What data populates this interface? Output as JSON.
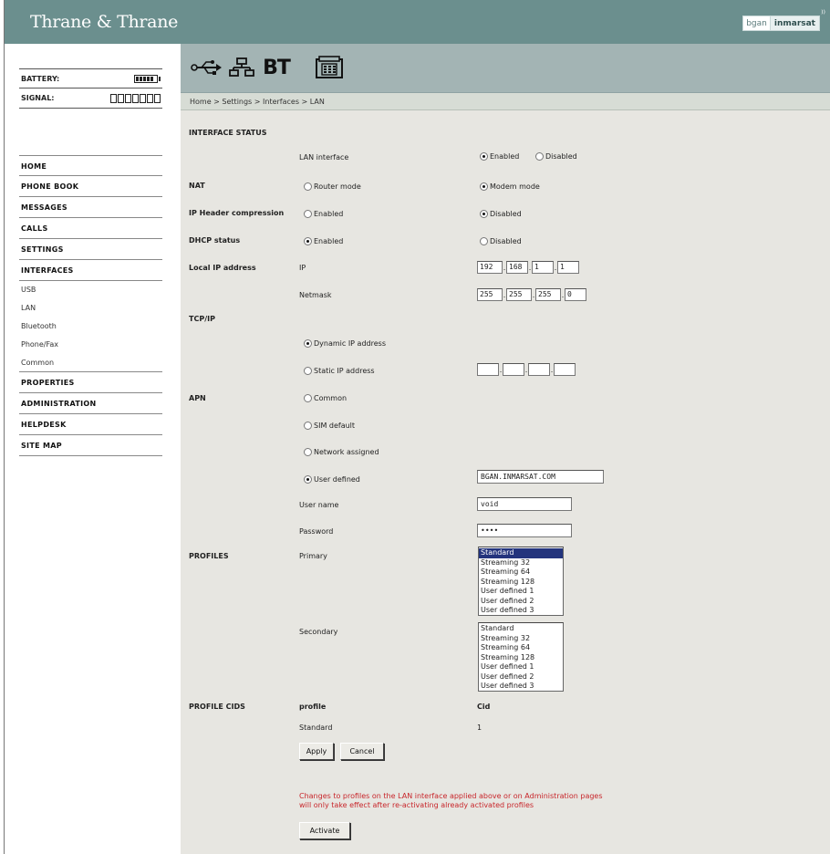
{
  "header": {
    "brand": "Thrane & Thrane",
    "partner_left": "bgan",
    "partner_right": "inmarsat"
  },
  "status": {
    "battery_label": "BATTERY:",
    "signal_label": "SIGNAL:",
    "signal_bars": 7
  },
  "menu": {
    "home": "HOME",
    "phone_book": "PHONE BOOK",
    "messages": "MESSAGES",
    "calls": "CALLS",
    "settings": "SETTINGS",
    "interfaces": "INTERFACES",
    "sub_usb": "USB",
    "sub_lan": "LAN",
    "sub_bluetooth": "Bluetooth",
    "sub_phonefax": "Phone/Fax",
    "sub_common": "Common",
    "properties": "PROPERTIES",
    "administration": "ADMINISTRATION",
    "helpdesk": "HELPDESK",
    "site_map": "SITE MAP"
  },
  "iconbar": {
    "bt_label": "BT"
  },
  "breadcrumb": "Home > Settings > Interfaces > LAN",
  "form": {
    "interface_status": {
      "title": "INTERFACE STATUS",
      "label": "LAN interface",
      "enabled": "Enabled",
      "disabled": "Disabled",
      "selected": "Enabled"
    },
    "nat": {
      "title": "NAT",
      "router": "Router mode",
      "modem": "Modem mode",
      "selected": "Modem mode"
    },
    "ip_header": {
      "title": "IP Header compression",
      "enabled": "Enabled",
      "disabled": "Disabled",
      "selected": "Disabled"
    },
    "dhcp": {
      "title": "DHCP status",
      "enabled": "Enabled",
      "disabled": "Disabled",
      "selected": "Enabled"
    },
    "local_ip": {
      "title": "Local IP address",
      "ip_label": "IP",
      "ip": [
        "192",
        "168",
        "1",
        "1"
      ],
      "netmask_label": "Netmask",
      "netmask": [
        "255",
        "255",
        "255",
        "0"
      ]
    },
    "tcpip": {
      "title": "TCP/IP",
      "dynamic": "Dynamic IP address",
      "static": "Static IP address",
      "selected": "Dynamic IP address"
    },
    "apn": {
      "title": "APN",
      "common": "Common",
      "sim_default": "SIM default",
      "network": "Network assigned",
      "user_defined": "User defined",
      "selected": "User defined",
      "value": "BGAN.INMARSAT.COM",
      "username_label": "User name",
      "username": "void",
      "password_label": "Password",
      "password": "••••"
    },
    "profiles": {
      "title": "PROFILES",
      "primary_label": "Primary",
      "secondary_label": "Secondary",
      "options": [
        "Standard",
        "Streaming 32",
        "Streaming 64",
        "Streaming 128",
        "User defined 1",
        "User defined 2",
        "User defined 3"
      ],
      "primary_selected": "Standard"
    },
    "profile_cids": {
      "title": "PROFILE CIDS",
      "col_profile": "profile",
      "col_cid": "Cid",
      "row_profile": "Standard",
      "row_cid": "1"
    },
    "apply": "Apply",
    "cancel": "Cancel",
    "warning_line1": "Changes to profiles on the LAN interface applied above or on Administration pages",
    "warning_line2": "will only take effect after re-activating already activated profiles",
    "activate": "Activate"
  }
}
